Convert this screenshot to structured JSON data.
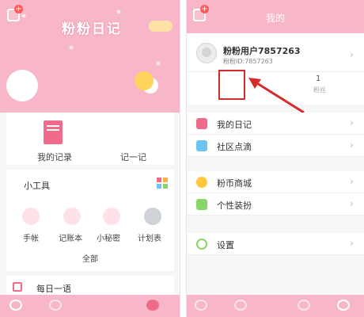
{
  "left_screen": {
    "header": {
      "app_title": "粉粉日记",
      "add_icon": "add-icon"
    },
    "records": {
      "my_records_label": "我的记录",
      "write_label": "记一记"
    },
    "tools": {
      "section_title": "小工具",
      "items": [
        {
          "label": "手帐",
          "icon": "pen-icon",
          "color": "#ffe1e8"
        },
        {
          "label": "记账本",
          "icon": "bag-icon",
          "color": "#ffe1e8"
        },
        {
          "label": "小秘密",
          "icon": "lock-icon",
          "color": "#ffe1e8"
        },
        {
          "label": "计划表",
          "icon": "calendar-icon",
          "color": "#cfd3d8"
        }
      ],
      "all_label": "全部"
    },
    "daily": {
      "label": "每日一语"
    }
  },
  "right_screen": {
    "header": {
      "title": "我的",
      "add_icon": "add-icon"
    },
    "profile": {
      "username": "粉粉用户7857263",
      "user_id": "粉粉ID:7857263"
    },
    "stats": [
      {
        "value": "1",
        "label": "粉丝"
      }
    ],
    "menu": [
      {
        "label": "我的日记",
        "icon": "diary-icon",
        "color": "#f06a8a"
      },
      {
        "label": "社区点滴",
        "icon": "community-icon",
        "color": "#6cc5f0"
      },
      {
        "label": "粉币商城",
        "icon": "coin-icon",
        "color": "#ffc83a"
      },
      {
        "label": "个性装扮",
        "icon": "leaf-icon",
        "color": "#8ad46c"
      },
      {
        "label": "设置",
        "icon": "gear-icon",
        "color": "#8ad46c"
      }
    ]
  },
  "colors": {
    "brand_pink": "#f7b7c8",
    "highlight_red": "#d42b2b"
  }
}
